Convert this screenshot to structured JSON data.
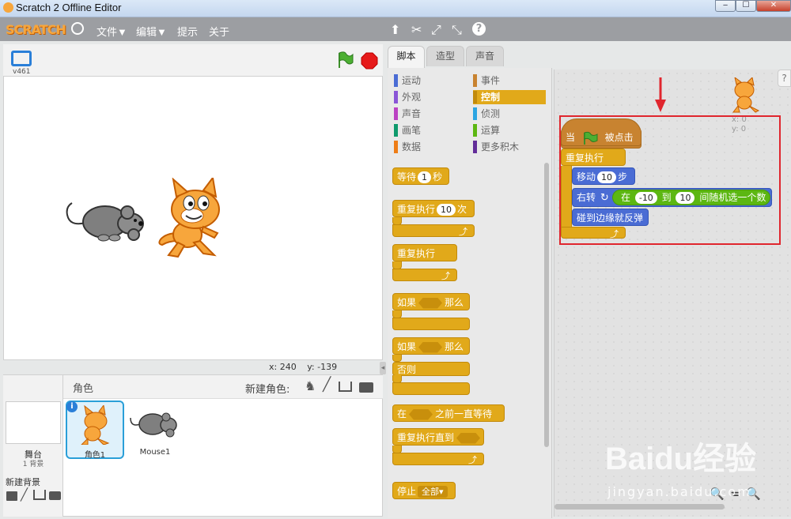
{
  "window": {
    "title": "Scratch 2 Offline Editor",
    "minimize": "‒",
    "maximize": "☐",
    "close": "✕"
  },
  "menu": {
    "logo": "SCRATCH",
    "file": "文件▼",
    "edit": "编辑▼",
    "tips": "提示",
    "about": "关于"
  },
  "stage": {
    "version": "v461",
    "x_label": "x:",
    "x_value": "240",
    "y_label": "y:",
    "y_value": "-139"
  },
  "sprites": {
    "title": "角色",
    "new_sprite_label": "新建角色:",
    "stage_label": "舞台",
    "stage_count": "1 背景",
    "new_backdrop": "新建背景",
    "items": [
      {
        "name": "角色1"
      },
      {
        "name": "Mouse1"
      }
    ]
  },
  "tabs": [
    {
      "label": "脚本"
    },
    {
      "label": "造型"
    },
    {
      "label": "声音"
    }
  ],
  "categories": {
    "left": [
      {
        "label": "运动",
        "color": "#4a6cd4"
      },
      {
        "label": "外观",
        "color": "#8a55d7"
      },
      {
        "label": "声音",
        "color": "#bb42c3"
      },
      {
        "label": "画笔",
        "color": "#0e9a6c"
      },
      {
        "label": "数据",
        "color": "#ee7d16"
      }
    ],
    "right": [
      {
        "label": "事件",
        "color": "#c88330"
      },
      {
        "label": "控制",
        "color": "#e1a91a"
      },
      {
        "label": "侦测",
        "color": "#2ca5e2"
      },
      {
        "label": "运算",
        "color": "#5cb712"
      },
      {
        "label": "更多积木",
        "color": "#632d99"
      }
    ]
  },
  "palette_blocks": {
    "wait": "等待",
    "wait_val": "1",
    "wait_unit": "秒",
    "repeat": "重复执行",
    "repeat_val": "10",
    "repeat_unit": "次",
    "forever": "重复执行",
    "if": "如果",
    "then": "那么",
    "if2": "如果",
    "then2": "那么",
    "else": "否则",
    "wait_until_pre": "在",
    "wait_until_post": "之前一直等待",
    "repeat_until": "重复执行直到",
    "stop": "停止",
    "stop_val": "全部▾"
  },
  "script": {
    "hat_when": "当",
    "hat_clicked": "被点击",
    "forever": "重复执行",
    "move": "移动",
    "move_val": "10",
    "move_unit": "步",
    "turn": "右转",
    "pick_at": "在",
    "pick_from": "-10",
    "pick_to_word": "到",
    "pick_to": "10",
    "pick_tail": "间随机选一个数",
    "bounce": "碰到边缘就反弹",
    "sprite_x": "x: 0",
    "sprite_y": "y: 0"
  },
  "watermark": {
    "main": "Baidu经验",
    "sub": "jingyan.baidu.com"
  }
}
